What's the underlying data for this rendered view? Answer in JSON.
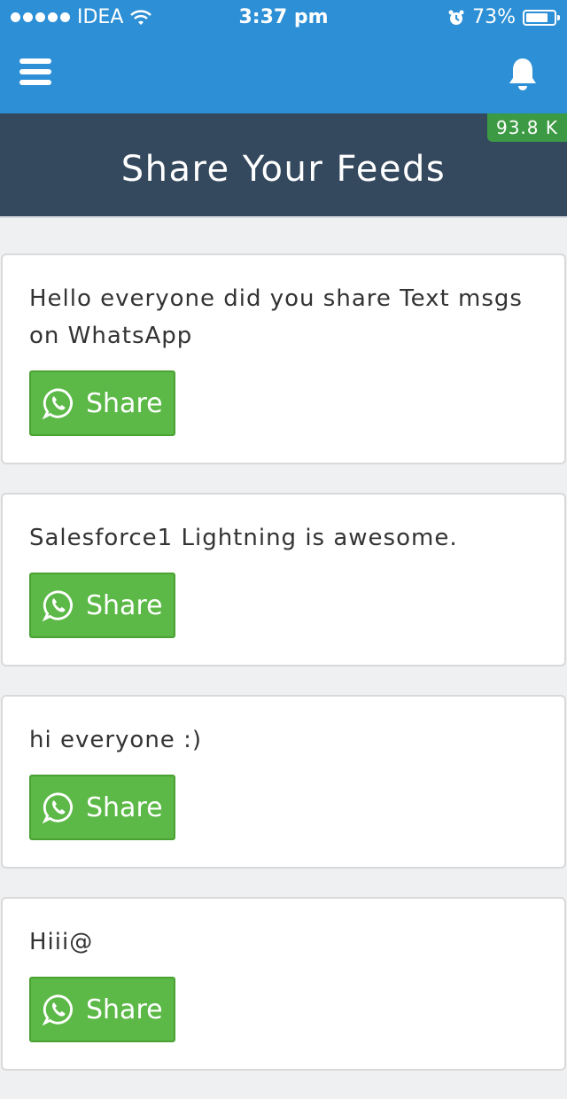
{
  "status_bar": {
    "carrier": "IDEA",
    "time": "3:37 pm",
    "battery": "73%"
  },
  "header": {
    "title": "Share Your Feeds",
    "badge": "93.8 K"
  },
  "icons": {
    "menu": "hamburger-menu-icon",
    "bell": "bell-icon",
    "share": "whatsapp-icon"
  },
  "colors": {
    "topbar": "#2d8fd5",
    "header": "#34495e",
    "share_button": "#5cb947",
    "badge": "#3c9a44"
  },
  "feeds": [
    {
      "text": "Hello everyone did you share Text msgs on WhatsApp",
      "button": "Share"
    },
    {
      "text": "Salesforce1 Lightning is awesome.",
      "button": "Share"
    },
    {
      "text": "hi everyone :)",
      "button": "Share"
    },
    {
      "text": "Hiii@",
      "button": "Share"
    }
  ]
}
